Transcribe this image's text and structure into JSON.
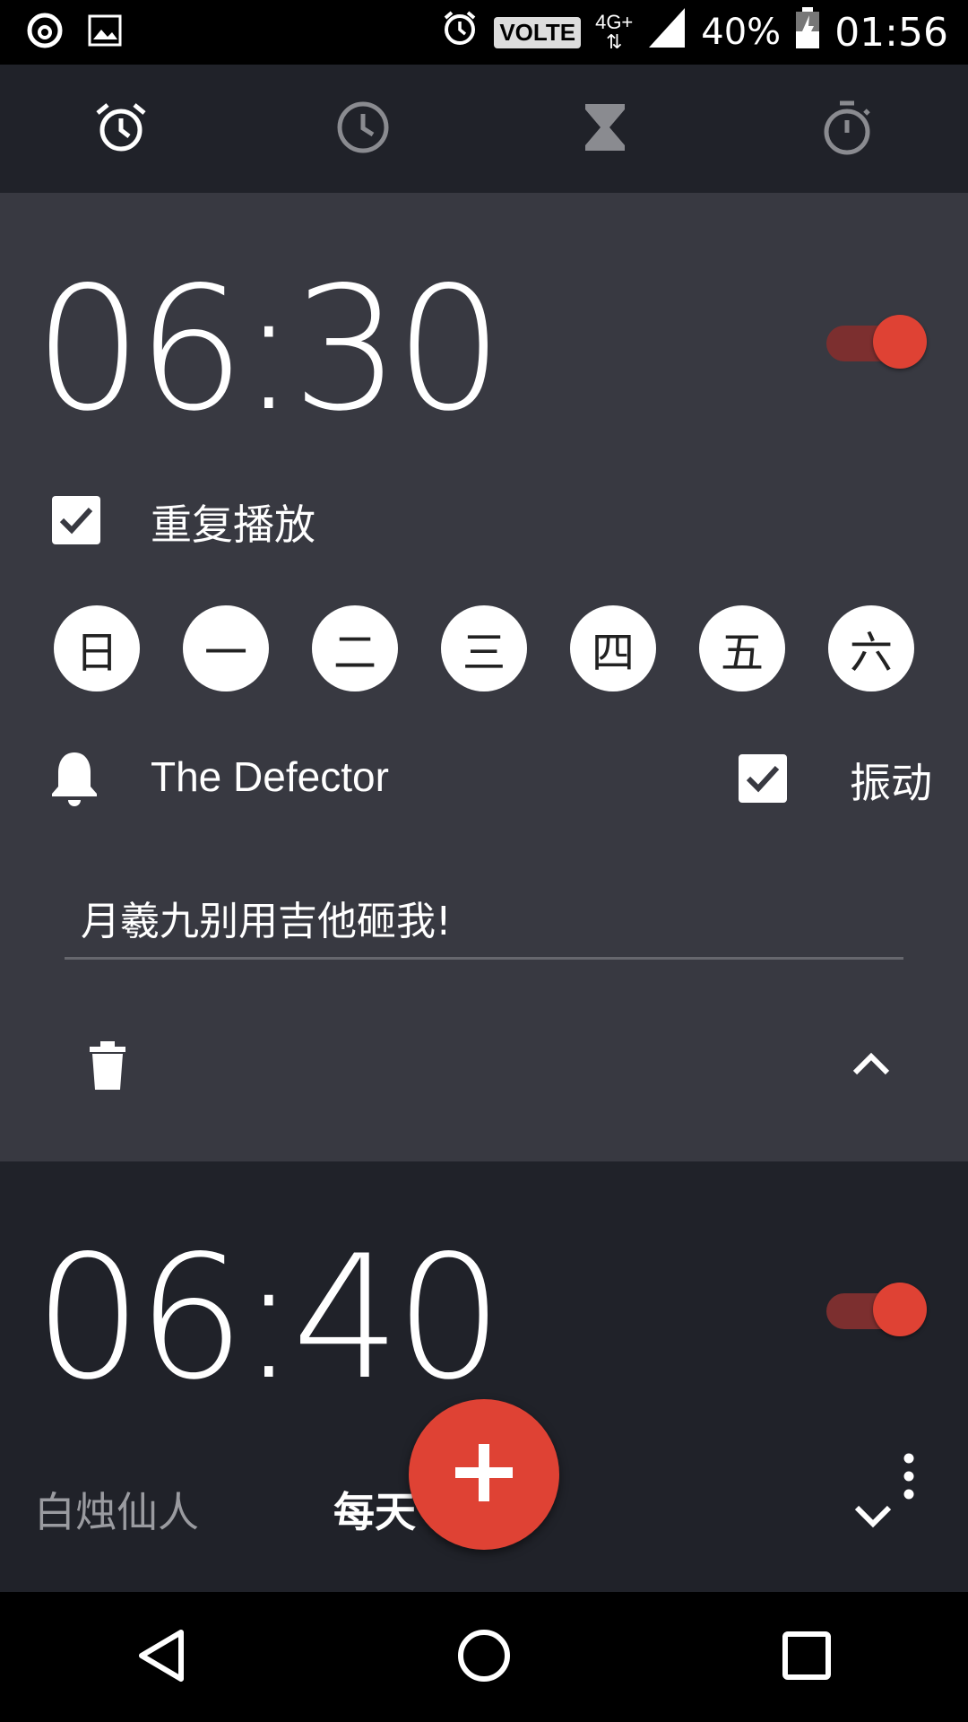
{
  "status_bar": {
    "volte": "VOLTE",
    "network": "4G+",
    "battery": "40%",
    "time": "01:56"
  },
  "tabs": [
    {
      "name": "alarm",
      "icon": "alarm-clock-icon",
      "active": true
    },
    {
      "name": "clock",
      "icon": "clock-icon",
      "active": false
    },
    {
      "name": "timer",
      "icon": "hourglass-icon",
      "active": false
    },
    {
      "name": "stopwatch",
      "icon": "stopwatch-icon",
      "active": false
    }
  ],
  "alarms": [
    {
      "time": "06:30",
      "enabled": true,
      "repeat_label": "重复播放",
      "repeat_checked": true,
      "days": [
        "日",
        "一",
        "二",
        "三",
        "四",
        "五",
        "六"
      ],
      "ringtone": "The Defector",
      "vibrate_label": "振动",
      "vibrate_checked": true,
      "label": "月羲九别用吉他砸我!"
    },
    {
      "time": "06:40",
      "enabled": true,
      "label": "白烛仙人",
      "repeat_summary": "每天"
    }
  ],
  "colors": {
    "accent": "#df4234",
    "card_expanded": "#383941",
    "background": "#202229"
  }
}
